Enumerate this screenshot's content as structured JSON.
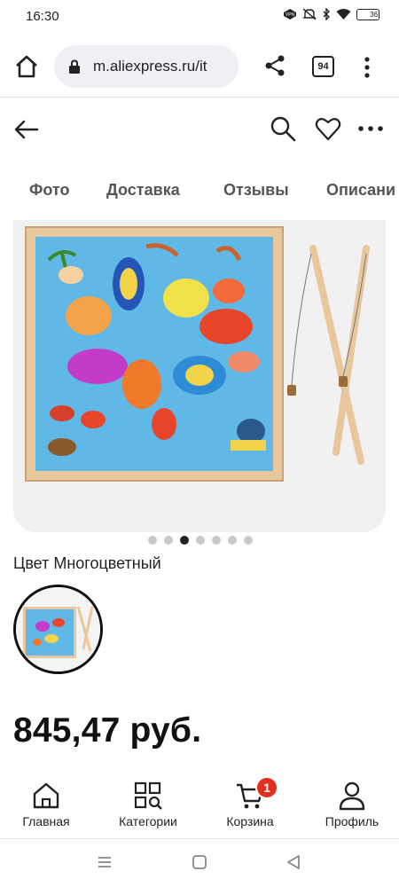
{
  "status_bar": {
    "time": "16:30",
    "icons": [
      "vpn-icon",
      "mute-icon",
      "bluetooth-icon",
      "wifi-icon",
      "battery-icon"
    ],
    "battery_level": "36"
  },
  "browser": {
    "url": "m.aliexpress.ru/it",
    "tab_count": "94"
  },
  "product_tabs": [
    "Фото",
    "Доставка",
    "Отзывы",
    "Описани"
  ],
  "gallery": {
    "dot_count": 7,
    "active_index": 2
  },
  "color": {
    "label": "Цвет Многоцветный"
  },
  "price": "845,47 руб.",
  "bottom_nav": {
    "home": "Главная",
    "categories": "Категории",
    "cart": "Корзина",
    "cart_badge": "1",
    "profile": "Профиль"
  },
  "colors": {
    "accent_red": "#e62e1f",
    "board_blue": "#5fb8e6",
    "wood": "#e8c79c"
  }
}
